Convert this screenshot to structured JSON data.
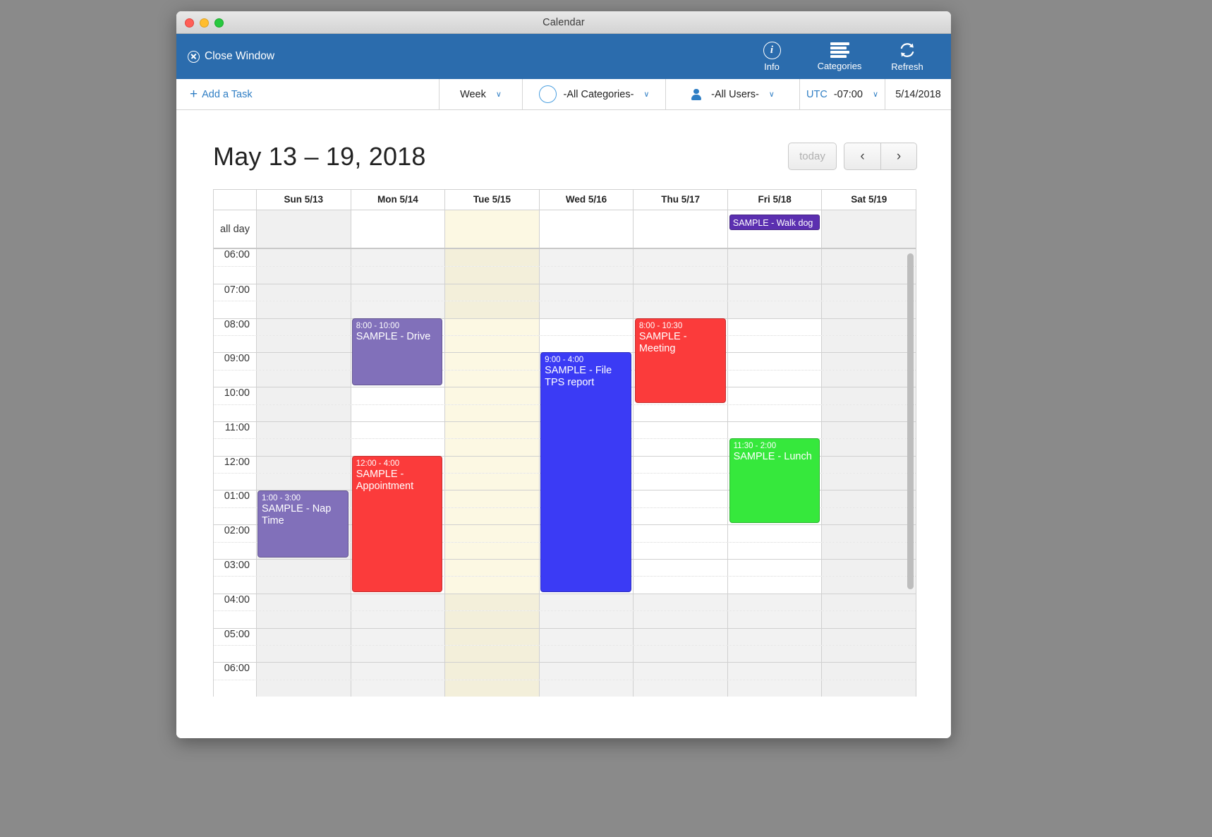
{
  "window": {
    "title": "Calendar"
  },
  "toolbar": {
    "close_label": "Close Window",
    "close_icon": "circle-x-icon",
    "buttons": [
      {
        "label": "Info",
        "icon": "info-icon"
      },
      {
        "label": "Categories",
        "icon": "hamburger-icon"
      },
      {
        "label": "Refresh",
        "icon": "refresh-icon"
      }
    ]
  },
  "filterbar": {
    "add_task": "Add a Task",
    "add_task_icon": "plus-icon",
    "view": "Week",
    "category": "-All Categories-",
    "category_icon": "circle-icon",
    "user": "-All Users-",
    "user_icon": "person-icon",
    "tz_label": "UTC",
    "tz_offset": "-07:00",
    "date": "5/14/2018",
    "chevron": "∨"
  },
  "calendar": {
    "title": "May 13 – 19, 2018",
    "today_label": "today",
    "prev_label": "‹",
    "next_label": "›",
    "allday_label": "all day",
    "days": [
      {
        "label": "Sun 5/13",
        "shaded": true,
        "today": false
      },
      {
        "label": "Mon 5/14",
        "shaded": false,
        "today": false
      },
      {
        "label": "Tue 5/15",
        "shaded": false,
        "today": true
      },
      {
        "label": "Wed 5/16",
        "shaded": false,
        "today": false
      },
      {
        "label": "Thu 5/17",
        "shaded": false,
        "today": false
      },
      {
        "label": "Fri 5/18",
        "shaded": false,
        "today": false
      },
      {
        "label": "Sat 5/19",
        "shaded": true,
        "today": false
      }
    ],
    "times": [
      "06:00",
      "07:00",
      "08:00",
      "09:00",
      "10:00",
      "11:00",
      "12:00",
      "01:00",
      "02:00",
      "03:00",
      "04:00",
      "05:00",
      "06:00"
    ],
    "allday_events": [
      {
        "day": 5,
        "name": "SAMPLE - Walk dog",
        "color": "#5b2fb0"
      }
    ],
    "events": [
      {
        "day": 1,
        "time": "8:00 - 10:00",
        "name": "SAMPLE - Drive",
        "color": "#8170ba",
        "start": 8.0,
        "end": 10.0
      },
      {
        "day": 0,
        "time": "1:00 - 3:00",
        "name": "SAMPLE - Nap Time",
        "color": "#8170ba",
        "start": 13.0,
        "end": 15.0
      },
      {
        "day": 1,
        "time": "12:00 - 4:00",
        "name": "SAMPLE - Appointment",
        "color": "#fb3b3b",
        "start": 12.0,
        "end": 16.0
      },
      {
        "day": 3,
        "time": "9:00 - 4:00",
        "name": "SAMPLE - File TPS report",
        "color": "#3b3bf5",
        "start": 9.0,
        "end": 16.0
      },
      {
        "day": 4,
        "time": "8:00 - 10:30",
        "name": "SAMPLE - Meeting",
        "color": "#fb3b3b",
        "start": 8.0,
        "end": 10.5
      },
      {
        "day": 5,
        "time": "11:30 - 2:00",
        "name": "SAMPLE - Lunch",
        "color": "#36e83c",
        "start": 11.5,
        "end": 14.0
      }
    ]
  },
  "colors": {
    "accent_blue": "#2b6cad",
    "link_blue": "#2f7ec4",
    "today_highlight": "#fcf8e3",
    "shaded_col": "#f0f0f0"
  }
}
